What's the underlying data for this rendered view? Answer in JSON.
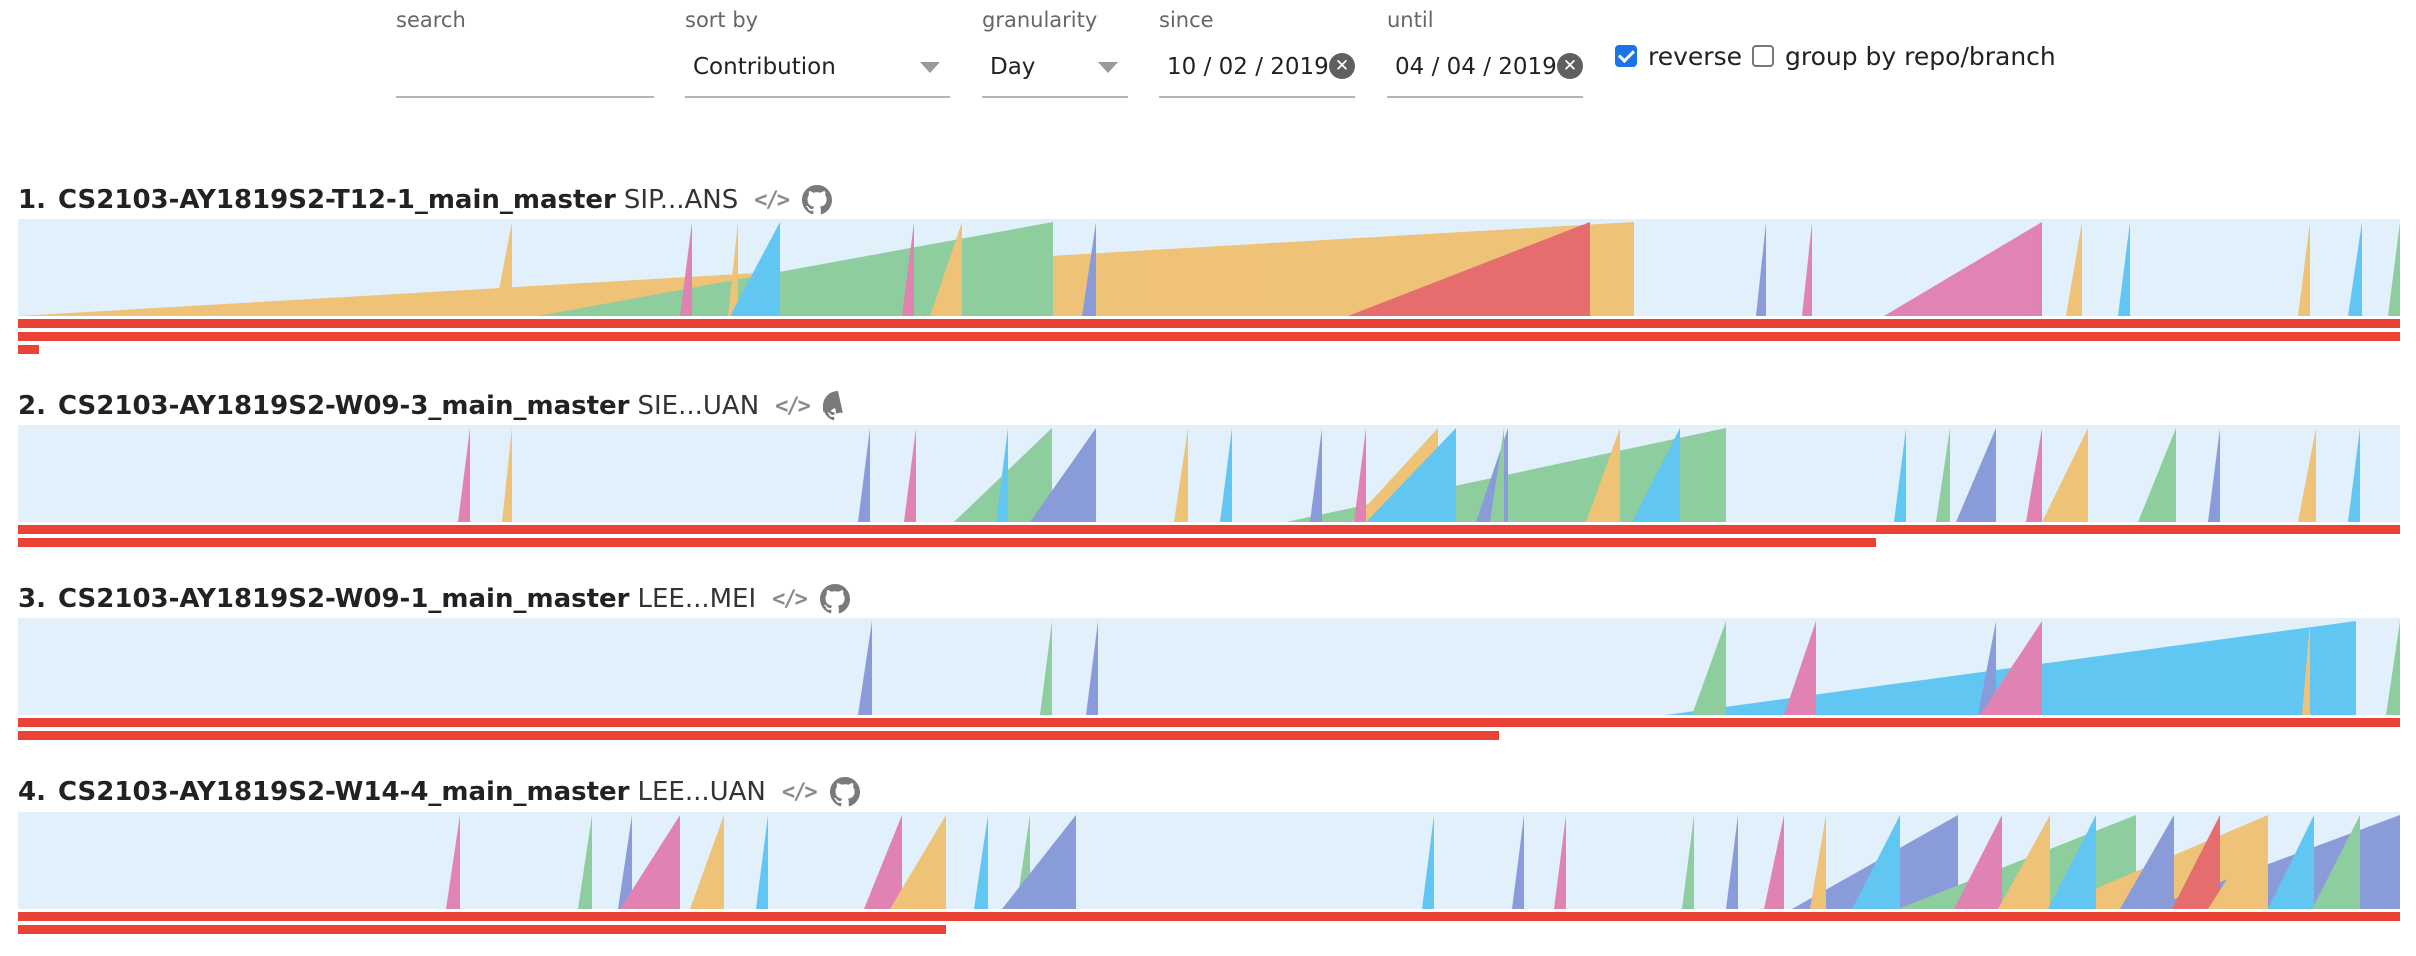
{
  "filters": {
    "search": {
      "label": "search",
      "value": ""
    },
    "sort_by": {
      "label": "sort by",
      "value": "Contribution"
    },
    "granularity": {
      "label": "granularity",
      "value": "Day"
    },
    "since": {
      "label": "since",
      "value": "10 / 02 / 2019"
    },
    "until": {
      "label": "until",
      "value": "04 / 04 / 2019"
    },
    "reverse": {
      "label": "reverse",
      "checked": true
    },
    "group_by": {
      "label": "group by repo/branch",
      "checked": false
    }
  },
  "colors": {
    "ramp_background": "#e2f0fb",
    "bar": "#ea4335",
    "checkbox_checked": "#1a73e8",
    "ramp_palette": {
      "orange": "#f3b34c",
      "green": "#71c27f",
      "blue": "#36b9f0",
      "purple": "#6d7fcf",
      "pink": "#e05f9c",
      "red": "#e8423f"
    }
  },
  "icons": [
    "code-icon",
    "github-icon",
    "clear-icon",
    "caret-down-icon"
  ],
  "repos": [
    {
      "rank": "1.",
      "name": "CS2103-AY1819S2-T12-1_main_master",
      "author": "SIP...ANS",
      "bar_fraction": 1.0
    },
    {
      "rank": "2.",
      "name": "CS2103-AY1819S2-W09-3_main_master",
      "author": "SIE...UAN",
      "bar_fraction": 0.78
    },
    {
      "rank": "3.",
      "name": "CS2103-AY1819S2-W09-1_main_master",
      "author": "LEE...MEI",
      "bar_fraction": 0.62
    },
    {
      "rank": "4.",
      "name": "CS2103-AY1819S2-W14-4_main_master",
      "author": "LEE...UAN",
      "bar_fraction": 0.39
    }
  ]
}
